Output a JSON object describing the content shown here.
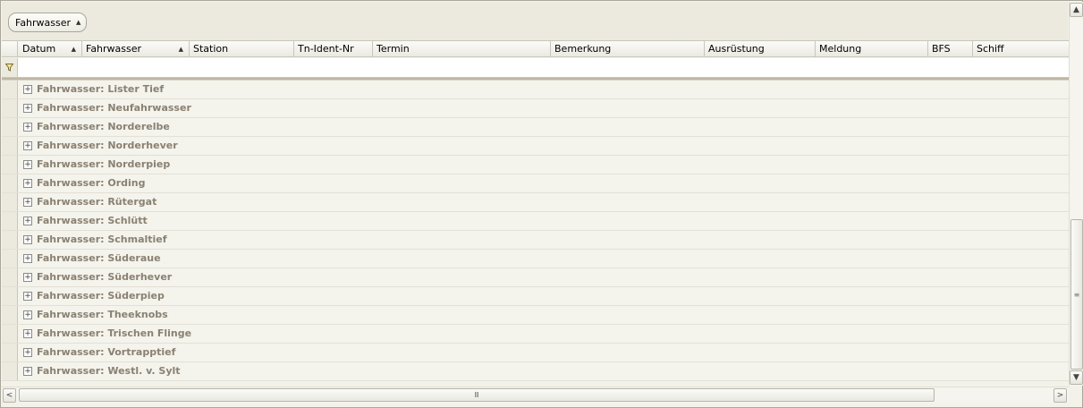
{
  "group_panel": {
    "chip_label": "Fahrwasser",
    "chip_arrow": "▲"
  },
  "header": {
    "columns": [
      {
        "label": "Datum",
        "sort": "▲"
      },
      {
        "label": "Fahrwasser",
        "sort": "▲"
      },
      {
        "label": "Station",
        "sort": ""
      },
      {
        "label": "Tn-Ident-Nr",
        "sort": ""
      },
      {
        "label": "Termin",
        "sort": ""
      },
      {
        "label": "Bemerkung",
        "sort": ""
      },
      {
        "label": "Ausrüstung",
        "sort": ""
      },
      {
        "label": "Meldung",
        "sort": ""
      },
      {
        "label": "BFS",
        "sort": ""
      },
      {
        "label": "Schiff",
        "sort": ""
      }
    ]
  },
  "filter_row": {
    "icon": "filter-icon"
  },
  "groups": [
    {
      "label": "Fahrwasser: Lister Tief"
    },
    {
      "label": "Fahrwasser: Neufahrwasser"
    },
    {
      "label": "Fahrwasser: Norderelbe"
    },
    {
      "label": "Fahrwasser: Norderhever"
    },
    {
      "label": "Fahrwasser: Norderpiep"
    },
    {
      "label": "Fahrwasser: Ording"
    },
    {
      "label": "Fahrwasser: Rütergat"
    },
    {
      "label": "Fahrwasser: Schlütt"
    },
    {
      "label": "Fahrwasser: Schmaltief"
    },
    {
      "label": "Fahrwasser: Süderaue"
    },
    {
      "label": "Fahrwasser: Süderhever"
    },
    {
      "label": "Fahrwasser: Süderpiep"
    },
    {
      "label": "Fahrwasser: Theeknobs"
    },
    {
      "label": "Fahrwasser: Trischen Flinge"
    },
    {
      "label": "Fahrwasser: Vortrapptief"
    },
    {
      "label": "Fahrwasser: Westl. v. Sylt"
    }
  ],
  "glyphs": {
    "expand": "+",
    "up": "▲",
    "down": "▼",
    "left": "<",
    "right": ">",
    "grip_v": "≡",
    "grip_h": "Ⅲ"
  }
}
